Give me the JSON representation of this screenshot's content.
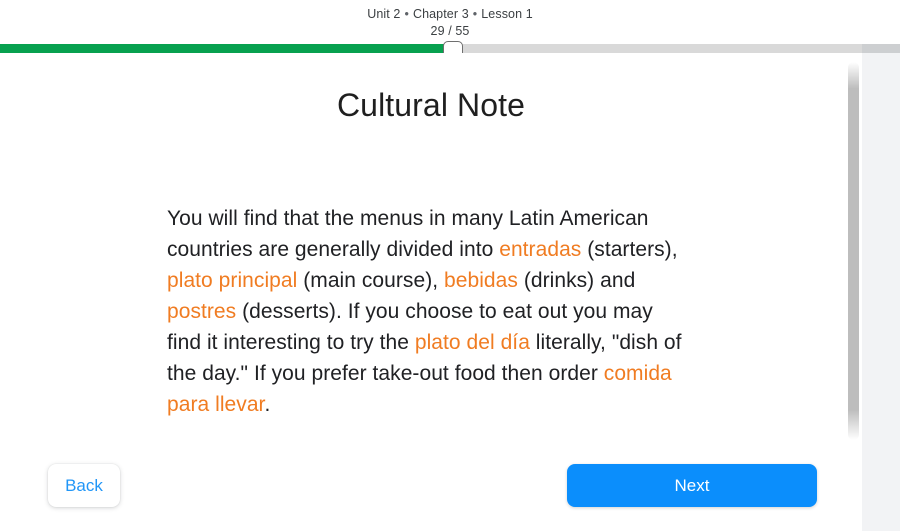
{
  "header": {
    "unit": "Unit 2",
    "chapter": "Chapter 3",
    "lesson": "Lesson 1",
    "separator": "•",
    "progress_label": "29 / 55"
  },
  "progress": {
    "current": 29,
    "total": 55,
    "percent": 50.3,
    "fill_color": "#07a14f",
    "track_color": "#d9d9d9",
    "handle_name": "progress-scrubber-handle"
  },
  "content": {
    "title": "Cultural Note",
    "accent_color": "#f07c22",
    "paragraph": [
      {
        "text": "You will find that the menus in many Latin American countries are generally divided into ",
        "style": "normal"
      },
      {
        "text": "entradas",
        "style": "spanish"
      },
      {
        "text": " (starters), ",
        "style": "normal"
      },
      {
        "text": "plato principal",
        "style": "spanish"
      },
      {
        "text": " (main course), ",
        "style": "normal"
      },
      {
        "text": "bebidas",
        "style": "spanish"
      },
      {
        "text": " (drinks) and ",
        "style": "normal"
      },
      {
        "text": "postres",
        "style": "spanish"
      },
      {
        "text": " (desserts).  If you choose to eat out you may find it interesting to try the ",
        "style": "normal"
      },
      {
        "text": "plato del día",
        "style": "spanish"
      },
      {
        "text": " literally, \"dish of the day.\"   If you prefer take-out food then order ",
        "style": "normal"
      },
      {
        "text": "comida para llevar",
        "style": "spanish"
      },
      {
        "text": ".",
        "style": "normal"
      }
    ]
  },
  "scrollbar": {
    "thumb_color": "#bdbdbd",
    "position": "right"
  },
  "footer": {
    "back_label": "Back",
    "next_label": "Next",
    "next_color": "#0b8efc",
    "back_text_color": "#2196f7"
  }
}
